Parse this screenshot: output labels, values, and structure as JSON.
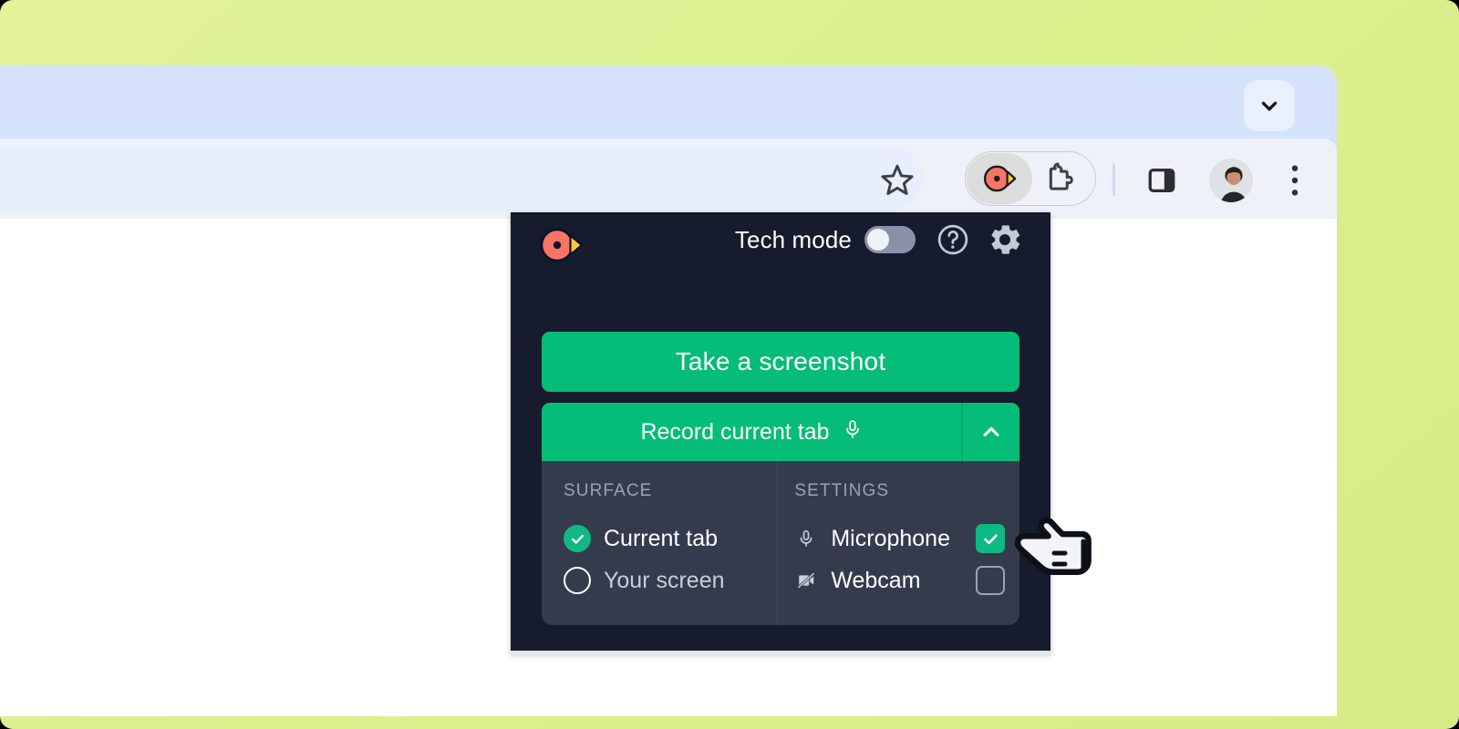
{
  "theme": {
    "desktop_bg": "#dcf08f",
    "browser_tabstrip_bg": "#d4e3fb",
    "toolbar_bg": "#eef1f8",
    "page_bg": "#ffffff",
    "panel_bg": "#161b2e",
    "dropdown_bg": "#343b4d",
    "accent_green": "#05bd78",
    "check_green": "#10b981",
    "logo_red": "#f97466",
    "logo_yellow": "#ffc93c"
  },
  "browser": {
    "collapse_button": {
      "name": "chevron-down-icon",
      "label": ""
    },
    "toolbar_icons": [
      {
        "name": "bookmark-star-icon",
        "label": "Bookmark this tab"
      },
      {
        "name": "extension-screencast-icon",
        "label": "Screencastify"
      },
      {
        "name": "puzzle-extensions-icon",
        "label": "Extensions"
      },
      {
        "name": "side-panel-icon",
        "label": "Side panel"
      },
      {
        "name": "profile-avatar",
        "label": "Profile"
      },
      {
        "name": "kebab-menu-icon",
        "label": "Customize and control"
      }
    ]
  },
  "extension_panel": {
    "logo_name": "screencastify-logo",
    "tech_mode": {
      "label": "Tech mode",
      "enabled": false,
      "state_text": "Off"
    },
    "help_icon_label": "Help",
    "settings_icon_label": "Settings",
    "screenshot_button": "Take a screenshot",
    "record_button": "Record current tab",
    "record_mic_icon": "microphone-icon",
    "record_dropdown_icon": "chevron-up-icon",
    "dropdown": {
      "surface": {
        "heading": "SURFACE",
        "options": [
          {
            "label": "Current tab",
            "selected": true
          },
          {
            "label": "Your screen",
            "selected": false
          }
        ]
      },
      "settings": {
        "heading": "SETTINGS",
        "options": [
          {
            "label": "Microphone",
            "icon": "microphone-icon",
            "checked": true
          },
          {
            "label": "Webcam",
            "icon": "webcam-off-icon",
            "checked": false
          }
        ]
      }
    }
  },
  "cursor": {
    "name": "pointing-hand-cursor"
  }
}
